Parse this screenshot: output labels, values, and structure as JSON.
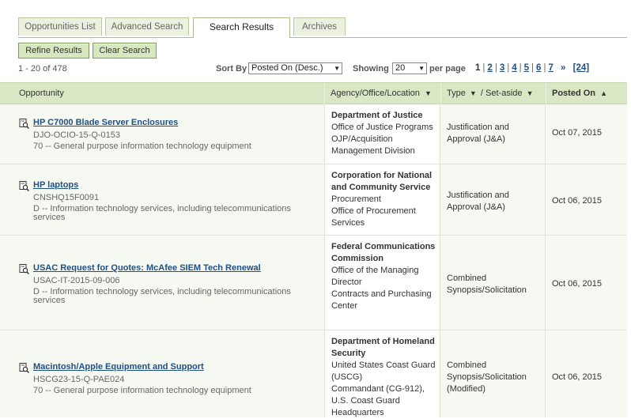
{
  "tabs": [
    {
      "label": "Opportunities List",
      "active": false
    },
    {
      "label": "Advanced Search",
      "active": false
    },
    {
      "label": "Search Results",
      "active": true
    },
    {
      "label": "Archives",
      "active": false
    }
  ],
  "buttons": {
    "refine": "Refine Results",
    "clear": "Clear Search"
  },
  "results_range": "1 - 20 of 478",
  "sort": {
    "label": "Sort By",
    "value": "Posted On (Desc.)"
  },
  "showing": {
    "label": "Showing",
    "value": "20",
    "suffix": "per page"
  },
  "pager": {
    "current": "1",
    "pages": [
      "2",
      "3",
      "4",
      "5",
      "6",
      "7"
    ],
    "next": "»",
    "last": "[24]"
  },
  "columns": {
    "opportunity": "Opportunity",
    "agency": "Agency/Office/Location",
    "type": "Type",
    "setaside": "Set-aside",
    "posted": "Posted On",
    "down_arrow": "▼",
    "up_arrow": "▲",
    "slash": "/"
  },
  "rows": [
    {
      "title": "HP C7000 Blade Server Enclosures",
      "solicitation": "DJO-OCIO-15-Q-0153",
      "classification": "70 -- General purpose information technology equipment",
      "agency": "Department of Justice",
      "offices": [
        "Office of Justice Programs",
        "OJP/Acquisition Management Division"
      ],
      "type": "Justification and Approval (J&A)",
      "posted": "Oct 07, 2015"
    },
    {
      "title": "HP laptops",
      "solicitation": "CNSHQ15F0091",
      "classification": "D -- Information technology services, including telecommunications services",
      "agency": "Corporation for National and Community Service",
      "offices": [
        "Procurement",
        "Office of Procurement Services"
      ],
      "type": "Justification and Approval (J&A)",
      "posted": "Oct 06, 2015"
    },
    {
      "title": "USAC Request for Quotes: McAfee SIEM Tech Renewal",
      "solicitation": "USAC-IT-2015-09-006",
      "classification": "D -- Information technology services, including telecommunications services",
      "agency": "Federal Communications Commission",
      "offices": [
        "Office of the Managing Director",
        "Contracts and Purchasing Center"
      ],
      "type": "Combined Synopsis/Solicitation",
      "posted": "Oct 06, 2015"
    },
    {
      "title": "Macintosh/Apple Equipment and Support",
      "solicitation": "HSCG23-15-Q-PAE024",
      "classification": "70 -- General purpose information technology equipment",
      "agency": "Department of Homeland Security",
      "offices": [
        "United States Coast Guard (USCG)",
        "Commandant (CG-912), U.S. Coast Guard Headquarters"
      ],
      "type": "Combined Synopsis/Solicitation (Modified)",
      "posted": "Oct 06, 2015"
    }
  ],
  "colors": {
    "accent_green": "#d9e7c5",
    "link_blue": "#1e4f86",
    "button_green": "#d7e8c1"
  },
  "icons": {
    "row_icon": "document-search-icon"
  }
}
